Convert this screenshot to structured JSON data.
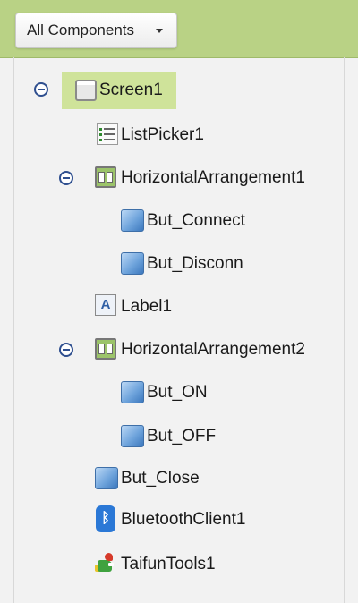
{
  "header": {
    "dropdown_label": "All Components"
  },
  "tree": {
    "screen": "Screen1",
    "listpicker": "ListPicker1",
    "harr1": "HorizontalArrangement1",
    "btn_connect": "But_Connect",
    "btn_disconn": "But_Disconn",
    "label": "Label1",
    "harr2": "HorizontalArrangement2",
    "btn_on": "But_ON",
    "btn_off": "But_OFF",
    "btn_close": "But_Close",
    "bt_client": "BluetoothClient1",
    "taifun": "TaifunTools1"
  },
  "icons": {
    "screen": "screen-icon",
    "listpicker": "listpicker-icon",
    "arrangement": "horizontal-arrangement-icon",
    "button": "button-icon",
    "label": "label-icon",
    "bluetooth": "bluetooth-icon",
    "extension": "extension-icon",
    "collapse": "collapse-icon"
  },
  "colors": {
    "header_bg": "#b9d285",
    "selected_bg": "#cfe39a",
    "toggle": "#2f4f8f"
  }
}
